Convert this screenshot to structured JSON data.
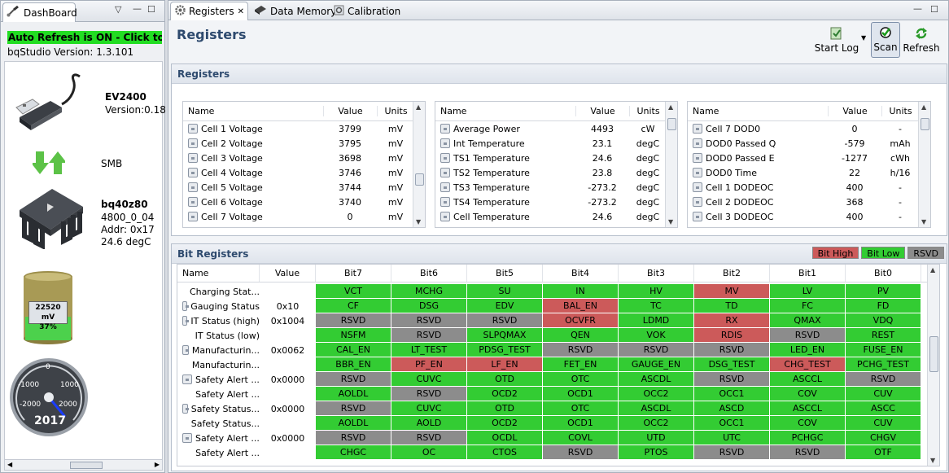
{
  "dashboard": {
    "tab_label": "DashBoard",
    "auto_refresh": "Auto Refresh is ON - Click to Turn",
    "version_label": "bqStudio Version:",
    "version_value": "1.3.101",
    "adapter_name": "EV2400",
    "adapter_version": "Version:0.18",
    "bus": "SMB",
    "device_name": "bq40z80",
    "device_fw": "4800_0_04",
    "device_addr": "Addr: 0x17",
    "device_temp": "24.6 degC",
    "battery_voltage": "22520 mV",
    "battery_percent": "37%",
    "battery_level": 0.37,
    "gauge_labels": {
      "zero": "0",
      "neg1000": "-1000",
      "pos1000": "1000",
      "neg2000": "-2000",
      "pos2000": "2000"
    },
    "gauge_value": "2017"
  },
  "tabs": [
    {
      "label": "Registers"
    },
    {
      "label": "Data Memory"
    },
    {
      "label": "Calibration"
    }
  ],
  "page": {
    "title": "Registers"
  },
  "toolbar": {
    "start_log": "Start Log",
    "scan": "Scan",
    "refresh": "Refresh"
  },
  "registers": {
    "section_title": "Registers",
    "columns": {
      "name": "Name",
      "value": "Value",
      "units": "Units"
    },
    "tables": [
      {
        "rows": [
          {
            "name": "Cell 1 Voltage",
            "value": "3799",
            "units": "mV"
          },
          {
            "name": "Cell 2 Voltage",
            "value": "3795",
            "units": "mV"
          },
          {
            "name": "Cell 3 Voltage",
            "value": "3698",
            "units": "mV"
          },
          {
            "name": "Cell 4 Voltage",
            "value": "3746",
            "units": "mV"
          },
          {
            "name": "Cell 5 Voltage",
            "value": "3744",
            "units": "mV"
          },
          {
            "name": "Cell 6 Voltage",
            "value": "3740",
            "units": "mV"
          },
          {
            "name": "Cell 7 Voltage",
            "value": "0",
            "units": "mV"
          }
        ]
      },
      {
        "rows": [
          {
            "name": "Average Power",
            "value": "4493",
            "units": "cW"
          },
          {
            "name": "Int Temperature",
            "value": "23.1",
            "units": "degC"
          },
          {
            "name": "TS1 Temperature",
            "value": "24.6",
            "units": "degC"
          },
          {
            "name": "TS2 Temperature",
            "value": "23.8",
            "units": "degC"
          },
          {
            "name": "TS3 Temperature",
            "value": "-273.2",
            "units": "degC"
          },
          {
            "name": "TS4 Temperature",
            "value": "-273.2",
            "units": "degC"
          },
          {
            "name": "Cell Temperature",
            "value": "24.6",
            "units": "degC"
          }
        ]
      },
      {
        "rows": [
          {
            "name": "Cell 7 DOD0",
            "value": "0",
            "units": "-"
          },
          {
            "name": "DOD0 Passed Q",
            "value": "-579",
            "units": "mAh"
          },
          {
            "name": "DOD0 Passed E",
            "value": "-1277",
            "units": "cWh"
          },
          {
            "name": "DOD0 Time",
            "value": "22",
            "units": "h/16"
          },
          {
            "name": "Cell 1 DODEOC",
            "value": "400",
            "units": "-"
          },
          {
            "name": "Cell 2 DODEOC",
            "value": "368",
            "units": "-"
          },
          {
            "name": "Cell 3 DODEOC",
            "value": "400",
            "units": "-"
          }
        ]
      }
    ]
  },
  "bit_registers": {
    "section_title": "Bit Registers",
    "legend": {
      "high": "Bit High",
      "low": "Bit Low",
      "rsvd": "RSVD"
    },
    "columns": [
      "Name",
      "Value",
      "Bit7",
      "Bit6",
      "Bit5",
      "Bit4",
      "Bit3",
      "Bit2",
      "Bit1",
      "Bit0"
    ],
    "rows": [
      {
        "name": "Charging Stat...",
        "value": "",
        "lock": false,
        "bits": [
          [
            "VCT",
            "low"
          ],
          [
            "MCHG",
            "low"
          ],
          [
            "SU",
            "low"
          ],
          [
            "IN",
            "low"
          ],
          [
            "HV",
            "low"
          ],
          [
            "MV",
            "high"
          ],
          [
            "LV",
            "low"
          ],
          [
            "PV",
            "low"
          ]
        ]
      },
      {
        "name": "Gauging Status",
        "value": "0x10",
        "lock": true,
        "bits": [
          [
            "CF",
            "low"
          ],
          [
            "DSG",
            "low"
          ],
          [
            "EDV",
            "low"
          ],
          [
            "BAL_EN",
            "high"
          ],
          [
            "TC",
            "low"
          ],
          [
            "TD",
            "low"
          ],
          [
            "FC",
            "low"
          ],
          [
            "FD",
            "low"
          ]
        ]
      },
      {
        "name": "IT Status (high)",
        "value": "0x1004",
        "lock": true,
        "bits": [
          [
            "RSVD",
            "rsvd"
          ],
          [
            "RSVD",
            "rsvd"
          ],
          [
            "RSVD",
            "rsvd"
          ],
          [
            "OCVFR",
            "high"
          ],
          [
            "LDMD",
            "low"
          ],
          [
            "RX",
            "high"
          ],
          [
            "QMAX",
            "low"
          ],
          [
            "VDQ",
            "low"
          ]
        ]
      },
      {
        "name": "IT Status (low)",
        "value": "",
        "lock": false,
        "bits": [
          [
            "NSFM",
            "low"
          ],
          [
            "RSVD",
            "rsvd"
          ],
          [
            "SLPQMAX",
            "low"
          ],
          [
            "QEN",
            "low"
          ],
          [
            "VOK",
            "low"
          ],
          [
            "RDIS",
            "high"
          ],
          [
            "RSVD",
            "rsvd"
          ],
          [
            "REST",
            "low"
          ]
        ]
      },
      {
        "name": "Manufacturin...",
        "value": "0x0062",
        "lock": true,
        "bits": [
          [
            "CAL_EN",
            "low"
          ],
          [
            "LT_TEST",
            "low"
          ],
          [
            "PDSG_TEST",
            "low"
          ],
          [
            "RSVD",
            "rsvd"
          ],
          [
            "RSVD",
            "rsvd"
          ],
          [
            "RSVD",
            "rsvd"
          ],
          [
            "LED_EN",
            "low"
          ],
          [
            "FUSE_EN",
            "low"
          ]
        ]
      },
      {
        "name": "Manufacturin...",
        "value": "",
        "lock": false,
        "bits": [
          [
            "BBR_EN",
            "low"
          ],
          [
            "PF_EN",
            "high"
          ],
          [
            "LF_EN",
            "high"
          ],
          [
            "FET_EN",
            "low"
          ],
          [
            "GAUGE_EN",
            "low"
          ],
          [
            "DSG_TEST",
            "low"
          ],
          [
            "CHG_TEST",
            "high"
          ],
          [
            "PCHG_TEST",
            "low"
          ]
        ]
      },
      {
        "name": "Safety Alert ...",
        "value": "0x0000",
        "lock": true,
        "bits": [
          [
            "RSVD",
            "rsvd"
          ],
          [
            "CUVC",
            "low"
          ],
          [
            "OTD",
            "low"
          ],
          [
            "OTC",
            "low"
          ],
          [
            "ASCDL",
            "low"
          ],
          [
            "RSVD",
            "rsvd"
          ],
          [
            "ASCCL",
            "low"
          ],
          [
            "RSVD",
            "rsvd"
          ]
        ]
      },
      {
        "name": "Safety Alert ...",
        "value": "",
        "lock": false,
        "bits": [
          [
            "AOLDL",
            "low"
          ],
          [
            "RSVD",
            "rsvd"
          ],
          [
            "OCD2",
            "low"
          ],
          [
            "OCD1",
            "low"
          ],
          [
            "OCC2",
            "low"
          ],
          [
            "OCC1",
            "low"
          ],
          [
            "COV",
            "low"
          ],
          [
            "CUV",
            "low"
          ]
        ]
      },
      {
        "name": "Safety Status...",
        "value": "0x0000",
        "lock": true,
        "bits": [
          [
            "RSVD",
            "rsvd"
          ],
          [
            "CUVC",
            "low"
          ],
          [
            "OTD",
            "low"
          ],
          [
            "OTC",
            "low"
          ],
          [
            "ASCDL",
            "low"
          ],
          [
            "ASCD",
            "low"
          ],
          [
            "ASCCL",
            "low"
          ],
          [
            "ASCC",
            "low"
          ]
        ]
      },
      {
        "name": "Safety Status...",
        "value": "",
        "lock": false,
        "bits": [
          [
            "AOLDL",
            "low"
          ],
          [
            "AOLD",
            "low"
          ],
          [
            "OCD2",
            "low"
          ],
          [
            "OCD1",
            "low"
          ],
          [
            "OCC2",
            "low"
          ],
          [
            "OCC1",
            "low"
          ],
          [
            "COV",
            "low"
          ],
          [
            "CUV",
            "low"
          ]
        ]
      },
      {
        "name": "Safety Alert ...",
        "value": "0x0000",
        "lock": true,
        "bits": [
          [
            "RSVD",
            "rsvd"
          ],
          [
            "RSVD",
            "rsvd"
          ],
          [
            "OCDL",
            "low"
          ],
          [
            "COVL",
            "low"
          ],
          [
            "UTD",
            "low"
          ],
          [
            "UTC",
            "low"
          ],
          [
            "PCHGC",
            "low"
          ],
          [
            "CHGV",
            "low"
          ]
        ]
      },
      {
        "name": "Safety Alert ...",
        "value": "",
        "lock": false,
        "bits": [
          [
            "CHGC",
            "low"
          ],
          [
            "OC",
            "low"
          ],
          [
            "CTOS",
            "low"
          ],
          [
            "RSVD",
            "rsvd"
          ],
          [
            "PTOS",
            "low"
          ],
          [
            "RSVD",
            "rsvd"
          ],
          [
            "RSVD",
            "rsvd"
          ],
          [
            "OTF",
            "low"
          ]
        ]
      }
    ]
  },
  "colors": {
    "bit_high": "#cc5a5a",
    "bit_low": "#33cc33",
    "rsvd": "#8c8c8c",
    "auto_refresh_bg": "#22dd22",
    "title": "#2e4a6e"
  },
  "icons": [
    "paintbrush-icon",
    "usb-plug-icon",
    "transfer-arrows-icon",
    "chip-icon",
    "battery-icon",
    "gauge-icon",
    "gear-icon",
    "memory-icon",
    "calibration-icon",
    "start-log-icon",
    "scan-icon",
    "refresh-icon",
    "lock-icon"
  ]
}
